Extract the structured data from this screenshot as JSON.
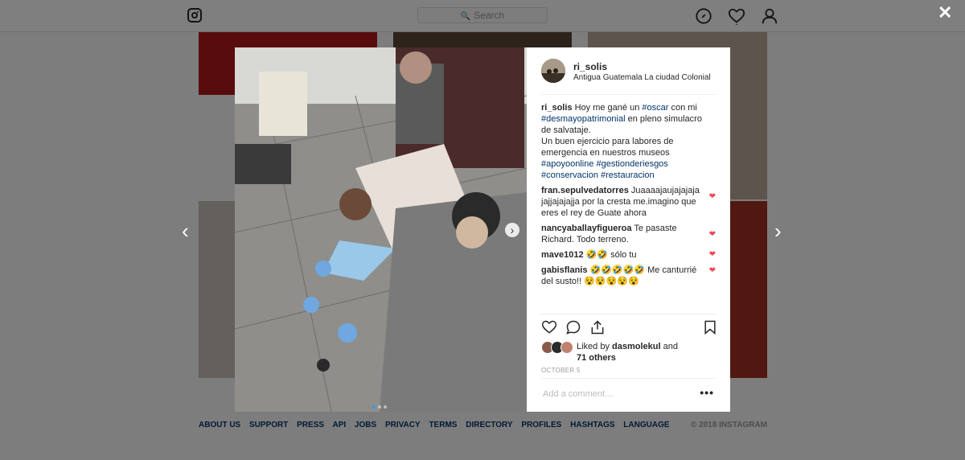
{
  "topbar": {
    "search_placeholder": "Search",
    "icons": [
      "instagram-logo-icon",
      "search-icon",
      "explore-compass-icon",
      "activity-heart-icon",
      "profile-icon"
    ]
  },
  "footer": {
    "links": [
      "ABOUT US",
      "SUPPORT",
      "PRESS",
      "API",
      "JOBS",
      "PRIVACY",
      "TERMS",
      "DIRECTORY",
      "PROFILES",
      "HASHTAGS",
      "LANGUAGE"
    ],
    "copyright": "© 2018 INSTAGRAM"
  },
  "lightbox": {
    "close": "✕",
    "prev": "‹",
    "next": "›"
  },
  "post": {
    "username": "ri_solis",
    "location": "Antigua Guatemala La ciudad Colonial",
    "caption": {
      "user": "ri_solis",
      "text1": "Hoy me gané un",
      "tag1": "#oscar",
      "text2": "con mi",
      "tag2": "#desmayopatrimonial",
      "text3": "en pleno simulacro de salvataje.",
      "text4": "Un buen ejercicio para labores de emergencia en nuestros museos",
      "tag3": "#apoyoonline",
      "tag4": "#gestionderiesgos",
      "tag5": "#conservacion",
      "tag6": "#restauracion"
    },
    "comments": [
      {
        "user": "fran.sepulvedatorres",
        "text": "Juaaaajaujajajaja jajjajajajja por la cresta me.imagino que eres el rey de Guate ahora"
      },
      {
        "user": "nancyaballayfigueroa",
        "text": "Te pasaste Richard. Todo terreno."
      },
      {
        "user": "mave1012",
        "text": "🤣🤣 sólo tu"
      },
      {
        "user": "gabisflanis",
        "text": "🤣🤣🤣🤣🤣 Me canturrié del susto!! 😵😵😵😵😵"
      }
    ],
    "likes": {
      "prefix": "Liked by",
      "user": "dasmolekul",
      "mid": "and",
      "others": "71 others"
    },
    "date": "OCTOBER 5",
    "add_comment_placeholder": "Add a comment…",
    "more": "•••",
    "carousel": {
      "count": 3,
      "active": 1
    }
  },
  "colors": {
    "link": "#003569",
    "like_heart": "#ed4956",
    "dot_active": "#3897f0"
  }
}
